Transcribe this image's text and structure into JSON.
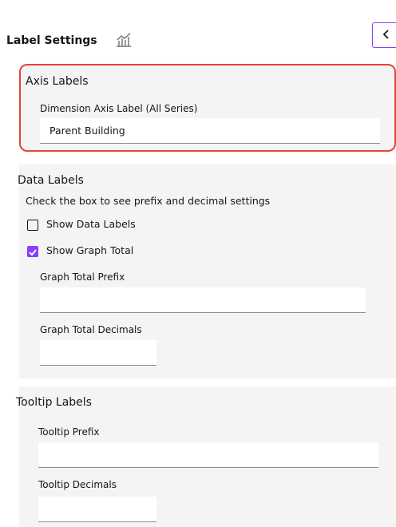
{
  "header": {
    "title": "Label Settings",
    "icon": "chart-settings-icon"
  },
  "axis_labels": {
    "title": "Axis Labels",
    "dimension_label": "Dimension Axis Label (All Series)",
    "dimension_value": "Parent Building"
  },
  "data_labels": {
    "title": "Data Labels",
    "hint": "Check the box to see prefix and decimal settings",
    "show_data_labels": {
      "label": "Show Data Labels",
      "checked": false
    },
    "show_graph_total": {
      "label": "Show Graph Total",
      "checked": true
    },
    "graph_total_prefix_label": "Graph Total Prefix",
    "graph_total_prefix_value": "",
    "graph_total_decimals_label": "Graph Total Decimals",
    "graph_total_decimals_value": ""
  },
  "tooltip_labels": {
    "title": "Tooltip Labels",
    "prefix_label": "Tooltip Prefix",
    "prefix_value": "",
    "decimals_label": "Tooltip Decimals",
    "decimals_value": ""
  },
  "colors": {
    "accent": "#8a3ffc",
    "highlight_border": "#e8433a",
    "section_bg": "#f4f4f4"
  }
}
